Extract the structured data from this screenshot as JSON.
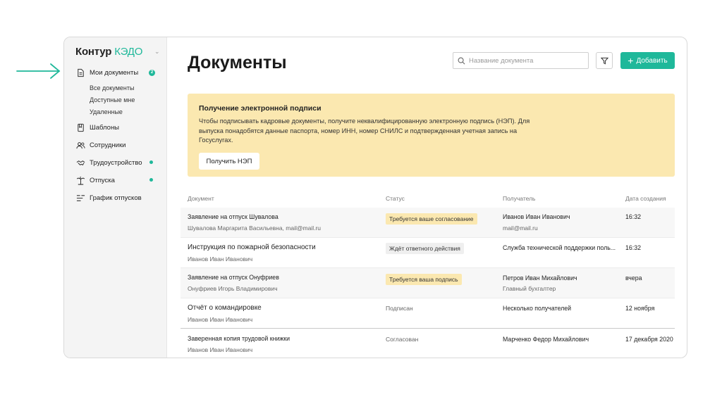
{
  "app": {
    "logo_part1": "Контур",
    "logo_part2": "КЭДО"
  },
  "sidebar": {
    "my_documents": "Мои документы",
    "my_documents_badge": "2",
    "sub_items": [
      "Все документы",
      "Доступные мне",
      "Удаленные"
    ],
    "items": [
      {
        "label": "Шаблоны",
        "icon": "bookmark-icon"
      },
      {
        "label": "Сотрудники",
        "icon": "users-icon"
      },
      {
        "label": "Трудоустройство",
        "icon": "handshake-icon",
        "dot": true
      },
      {
        "label": "Отпуска",
        "icon": "palm-icon",
        "dot": true
      },
      {
        "label": "График отпусков",
        "icon": "schedule-icon"
      }
    ]
  },
  "header": {
    "title": "Документы",
    "search_placeholder": "Название документа",
    "add_label": "Добавить"
  },
  "banner": {
    "title": "Получение электронной подписи",
    "text": "Чтобы подписывать кадровые документы, получите неквалифицированную электронную подпись (НЭП). Для выпуска понадобятся данные паспорта, номер ИНН, номер СНИЛС и подтвержденная учетная запись на Госуслугах.",
    "button": "Получить НЭП"
  },
  "table": {
    "columns": [
      "Документ",
      "Статус",
      "Получатель",
      "Дата создания"
    ],
    "rows": [
      {
        "doc": "Заявление на отпуск Шувалова",
        "doc_sub": "Шувалова Маргарита Васильевна, mail@mail.ru",
        "status": "Требуется ваше согласование",
        "status_style": "yellow",
        "recipient": "Иванов Иван Иванович",
        "recipient_sub": "mail@mail.ru",
        "date": "16:32"
      },
      {
        "doc": "Инструкция по пожарной безопасности",
        "doc_sub": "Иванов Иван Иванович",
        "status": "Ждёт ответного действия",
        "status_style": "gray",
        "recipient": "Служба технической поддержки поль...",
        "recipient_sub": "",
        "date": "16:32"
      },
      {
        "doc": "Заявление на отпуск Онуфриев",
        "doc_sub": "Онуфриев Игорь Владимирович",
        "status": "Требуется ваша подпись",
        "status_style": "yellow",
        "recipient": "Петров Иван Михайлович",
        "recipient_sub": "Главный бухгалтер",
        "date": "вчера"
      },
      {
        "doc": "Отчёт о командировке",
        "doc_sub": "Иванов Иван Иванович",
        "status": "Подписан",
        "status_style": "plain",
        "recipient": "Несколько получателей",
        "recipient_sub": "",
        "date": "12 ноября"
      },
      {
        "doc": "Заверенная копия трудовой книжки",
        "doc_sub": "Иванов Иван Иванович",
        "status": "Согласован",
        "status_style": "plain",
        "recipient": "Марченко Федор Михайлович",
        "recipient_sub": "",
        "date": "17 декабря 2020"
      }
    ]
  },
  "colors": {
    "accent": "#1fb89a",
    "banner": "#fbe8b0"
  }
}
